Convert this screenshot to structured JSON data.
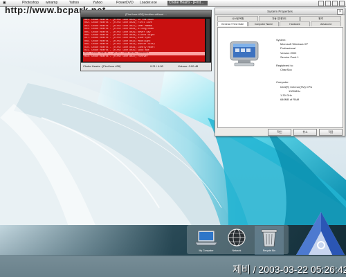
{
  "watermark": "http://www.bcpark.net",
  "taskbar": {
    "tasks": [
      "Photoshop",
      "winamp",
      "Yahoo",
      "Yahoo",
      "PowerDVD",
      "Loader.exe",
      "Choke Hearts - [First..."
    ]
  },
  "playlist": {
    "title": "[First love #26] Another without ...",
    "rows": [
      "001. Choke Hearts - [First love #025] In the Rain",
      "002. Choke Hearts - [First love #026] First Love",
      "003. Choke Hearts - [First love #027] Dear Mamma",
      "004. Choke Hearts - [First love #028] A Long Road",
      "005. Choke Hearts - [First love #029] Never Say",
      "006. Choke Hearts - [First love #030] Silent Night",
      "007. Choke Hearts - [First love #031] Blue Eyes",
      "008. Choke Hearts - [First love #032] Moonlight",
      "009. Choke Hearts - [First love #033] Winter Story",
      "010. Choke Hearts - [First love #034] Lonely Heart",
      "011. Choke Hearts - [First love #035] Good Bye",
      "012. Choke Hearts - [First love #036] Remember",
      "013. Choke Hearts - [First love #037] Forever"
    ],
    "selected_index": 11,
    "now_playing": "Choke Hearts - [First love #26]",
    "time": "0:21 / 4:00",
    "volume": "Volume: 0:00 dB"
  },
  "dialog": {
    "title": "System Properties",
    "tabs_row1": [
      "시스템 복원",
      "자동 업데이트",
      "원격"
    ],
    "tabs_row2": [
      "General / Time Date",
      "Computer Name",
      "Hardware",
      "Advanced"
    ],
    "system_header": "System:",
    "os": "Microsoft Windows XP",
    "edition": "Professional",
    "version": "Version 2002",
    "service_pack": "Service Pack 1",
    "registered_header": "Registered to:",
    "registered_to": "ChanSoo",
    "computer_header": "Computer:",
    "cpu": "Intel(R) Celeron(TM) CPU",
    "cpu_speed": "1300MHz",
    "clock": "1.30 GHz",
    "ram": "640MB of RAM",
    "ok": "확인",
    "cancel": "취소",
    "apply": "적용"
  },
  "dock": {
    "items": [
      {
        "label": "My Computer",
        "icon": "laptop-icon"
      },
      {
        "label": "Network",
        "icon": "globe-icon"
      },
      {
        "label": "Recycle Bin",
        "icon": "trash-icon"
      }
    ]
  },
  "timestamp": "제비 / 2003-03-22 05:26:42"
}
